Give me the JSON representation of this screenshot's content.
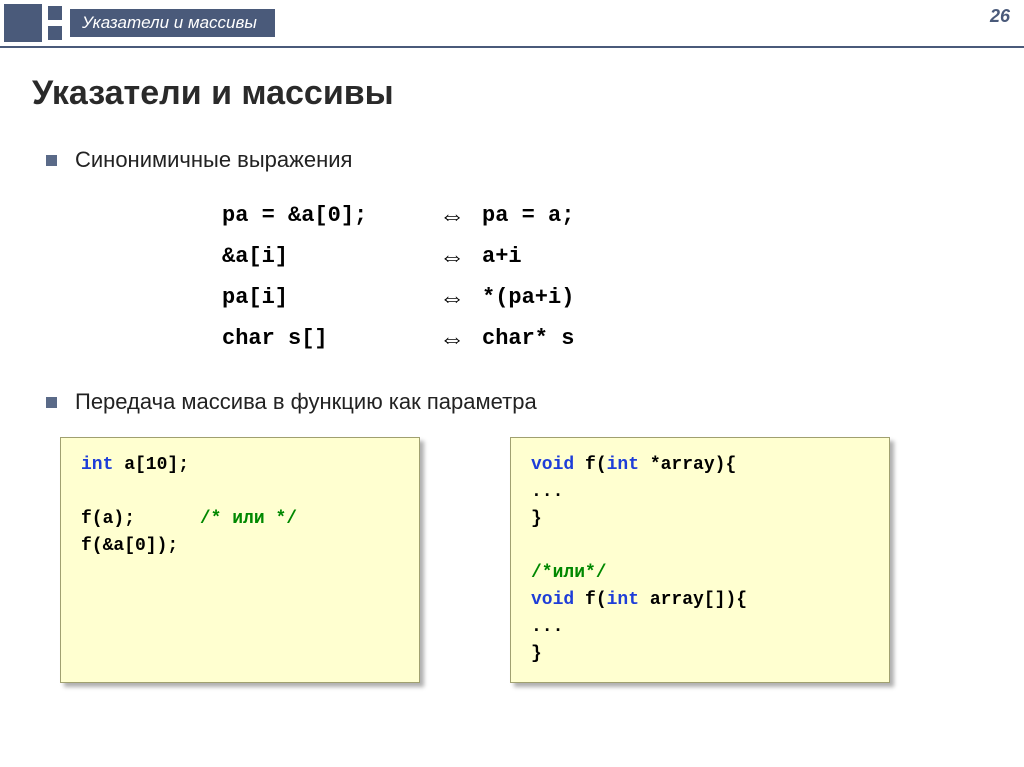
{
  "header": {
    "breadcrumb": "Указатели и массивы",
    "pageNumber": "26"
  },
  "title": "Указатели и массивы",
  "bullets": {
    "b1": "Синонимичные выражения",
    "b2": "Передача массива в функцию как параметра"
  },
  "equiv": {
    "r1": {
      "left": "pa = &a[0];",
      "right": "pa = a;"
    },
    "r2": {
      "left": "&a[i]",
      "right": "a+i"
    },
    "r3": {
      "left": "pa[i]",
      "right": "*(pa+i)"
    },
    "r4": {
      "left": "char s[]",
      "right": "char* s"
    }
  },
  "codeLeft": {
    "kw1": "int",
    "decl": " a[10];",
    "call1a": "f(a);",
    "call1pad": "      ",
    "cm1": "/* или */",
    "call2": "f(&a[0]);"
  },
  "codeRight": {
    "kw1": "void",
    "sig1a": " f(",
    "kw2": "int",
    "sig1b": " *array){",
    "body1": " ...",
    "close1": "}",
    "cm1": "/*или*/",
    "kw3": "void",
    "sig2a": " f(",
    "kw4": "int",
    "sig2b": " array[]){",
    "body2": " ...",
    "close2": "}"
  }
}
